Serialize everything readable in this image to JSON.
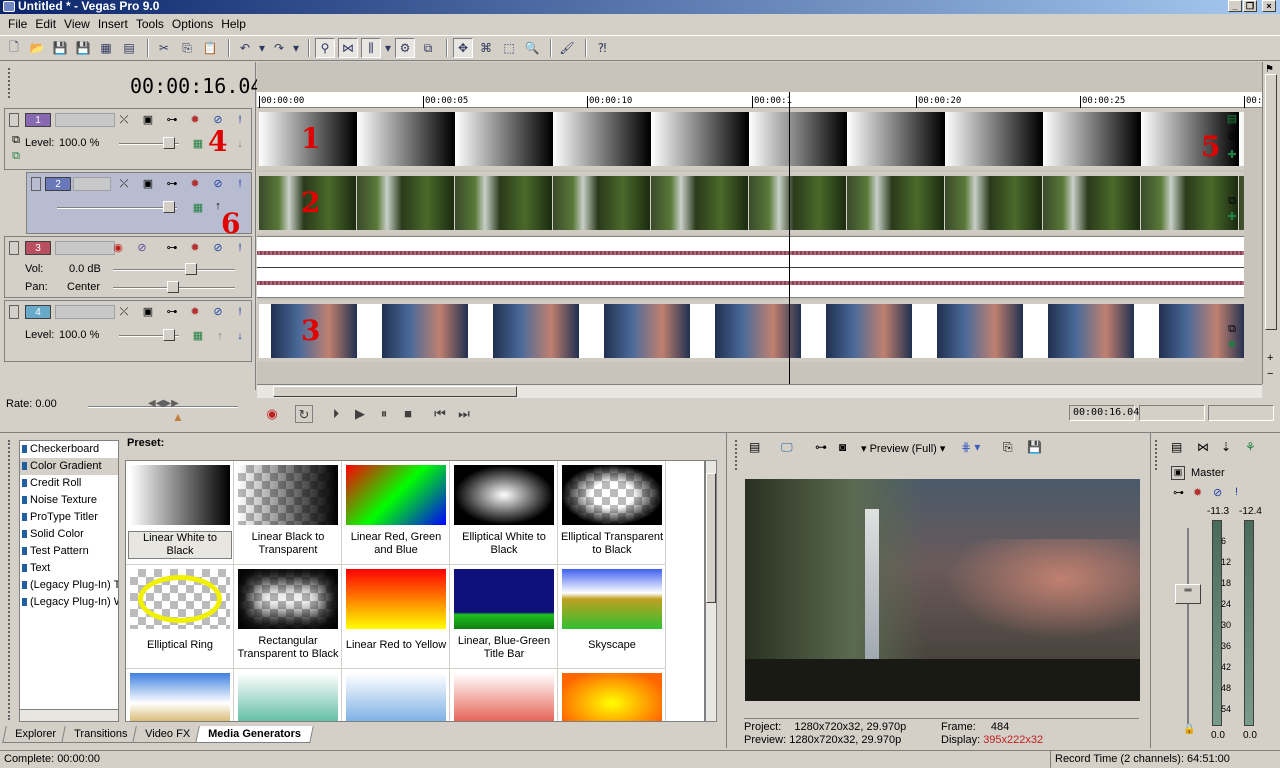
{
  "window": {
    "title": "Untitled * - Vegas Pro 9.0"
  },
  "menu": [
    "File",
    "Edit",
    "View",
    "Insert",
    "Tools",
    "Options",
    "Help"
  ],
  "timecode": "00:00:16.04",
  "ruler": [
    "00:00:00",
    "00:00:05",
    "00:00:10",
    "00:00:1",
    "00:00:20",
    "00:00:25",
    "00:00"
  ],
  "tracks": [
    {
      "num": "1",
      "color": "#8868b0",
      "level_label": "Level:",
      "level": "100.0 %",
      "badge": "4"
    },
    {
      "num": "2",
      "color": "#6878b8",
      "badge": "6"
    },
    {
      "num": "3",
      "color": "#b85060",
      "vol_label": "Vol:",
      "vol": "0.0 dB",
      "pan_label": "Pan:",
      "pan": "Center"
    },
    {
      "num": "4",
      "color": "#68a8c8",
      "level_label": "Level:",
      "level": "100.0 %"
    }
  ],
  "clip_badges": [
    "1",
    "2",
    "3",
    "5"
  ],
  "rate": "Rate: 0.00",
  "transport_timecode": "00:00:16.04",
  "generators": [
    "Checkerboard",
    "Color Gradient",
    "Credit Roll",
    "Noise Texture",
    "ProType Titler",
    "Solid Color",
    "Test Pattern",
    "Text",
    "(Legacy Plug-In) T",
    "(Legacy Plug-In) W"
  ],
  "preset_label": "Preset:",
  "presets": [
    "Linear White to Black",
    "Linear Black to Transparent",
    "Linear Red, Green and Blue",
    "Elliptical White to Black",
    "Elliptical Transparent to Black",
    "Elliptical Ring",
    "Rectangular Transparent to Black",
    "Linear Red to Yellow",
    "Linear, Blue-Green Title Bar",
    "Skyscape"
  ],
  "tabs": [
    "Explorer",
    "Transitions",
    "Video FX",
    "Media Generators"
  ],
  "preview": {
    "mode": "Preview (Full)",
    "project_label": "Project:",
    "project": "1280x720x32, 29.970p",
    "preview_label": "Preview:",
    "preview_val": "1280x720x32, 29.970p",
    "frame_label": "Frame:",
    "frame": "484",
    "display_label": "Display:",
    "display": "395x222x32"
  },
  "mixer": {
    "title": "Master",
    "left_peak": "-11.3",
    "right_peak": "-12.4",
    "scale": [
      "6",
      "12",
      "18",
      "24",
      "30",
      "36",
      "42",
      "48",
      "54"
    ],
    "left_bottom": "0.0",
    "right_bottom": "0.0"
  },
  "status": {
    "left": "Complete: 00:00:00",
    "right": "Record Time (2 channels): 64:51:00"
  }
}
